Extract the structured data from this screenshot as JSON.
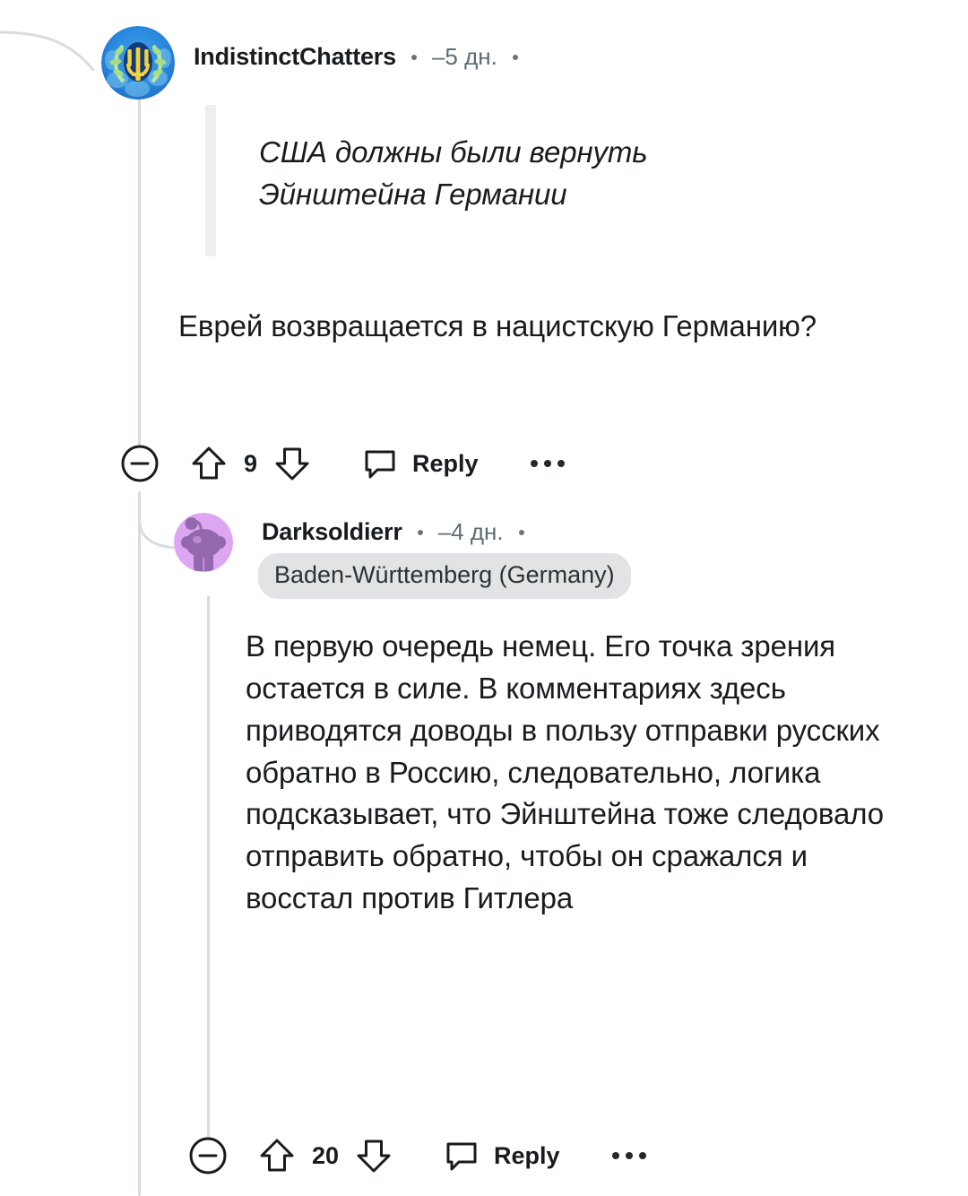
{
  "thread": {
    "comments": [
      {
        "id": "comment-1",
        "author": "IndistinctChatters",
        "timestamp": "–5 дн.",
        "avatar_icon": "ukraine-coat-of-arms-avatar",
        "quote": "США должны были вернуть Эйнштейна Германии",
        "body": "Еврей возвращается в нацистскую Германию?",
        "votes": "9",
        "reply_label": "Reply",
        "collapse_icon": "minus-circle-icon",
        "upvote_icon": "upvote-arrow-icon",
        "downvote_icon": "downvote-arrow-icon",
        "comment_icon": "speech-bubble-icon",
        "more_icon": "kebab-more-icon"
      },
      {
        "id": "comment-2",
        "author": "Darksoldierr",
        "timestamp": "–4 дн.",
        "avatar_icon": "snoo-purple-avatar",
        "flair": "Baden-Württemberg (Germany)",
        "body": "В первую очередь немец. Его точка зрения остается в силе. В комментариях здесь приводятся доводы в пользу отправки русских обратно в Россию, следовательно, логика подсказывает, что Эйнштейна тоже следовало отправить обратно, чтобы он сражался и восстал против Гитлера",
        "votes": "20",
        "reply_label": "Reply",
        "collapse_icon": "minus-circle-icon",
        "upvote_icon": "upvote-arrow-icon",
        "downvote_icon": "downvote-arrow-icon",
        "comment_icon": "speech-bubble-icon",
        "more_icon": "kebab-more-icon"
      }
    ]
  },
  "colors": {
    "background": "#FFFFFF",
    "text": "#181C1F",
    "meta_text": "#5C6C74",
    "thread_line": "#D8DCDE",
    "quote_bar": "#EDEEEE",
    "flair_background": "#E2E3E5",
    "avatar_snoo_background": "#DDA6F2",
    "avatar_snoo_body": "#9468AE"
  }
}
